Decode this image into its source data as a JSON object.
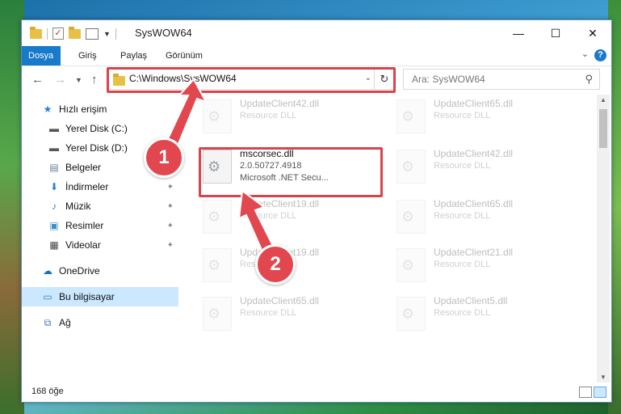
{
  "window": {
    "title": "SysWOW64",
    "minimize_glyph": "—",
    "maximize_glyph": "☐",
    "close_glyph": "✕"
  },
  "ribbon": {
    "tabs": [
      "Dosya",
      "Giriş",
      "Paylaş",
      "Görünüm"
    ],
    "collapse_glyph": "⌄",
    "help_glyph": "?"
  },
  "address": {
    "path": "C:\\Windows\\SysWOW64",
    "search_placeholder": "Ara: SysWOW64"
  },
  "sidebar": {
    "items": [
      {
        "label": "Hızlı erişim",
        "icon": "star-icon"
      },
      {
        "label": "Yerel Disk (C:)",
        "icon": "drive-icon"
      },
      {
        "label": "Yerel Disk (D:)",
        "icon": "drive-icon"
      },
      {
        "label": "Belgeler",
        "icon": "documents-icon"
      },
      {
        "label": "İndirmeler",
        "icon": "download-icon"
      },
      {
        "label": "Müzik",
        "icon": "music-icon"
      },
      {
        "label": "Resimler",
        "icon": "pictures-icon"
      },
      {
        "label": "Videolar",
        "icon": "video-icon"
      },
      {
        "label": "OneDrive",
        "icon": "cloud-icon"
      },
      {
        "label": "Bu bilgisayar",
        "icon": "computer-icon"
      },
      {
        "label": "Ağ",
        "icon": "network-icon"
      }
    ]
  },
  "files": {
    "highlighted": {
      "name": "mscorsec.dll",
      "version": "2.0.50727.4918",
      "description": "Microsoft .NET Secu..."
    },
    "faded": [
      {
        "name": "UpdateClient42.dll",
        "type": "Resource DLL"
      },
      {
        "name": "UpdateClient65.dll",
        "type": "Resource DLL"
      },
      {
        "name": "UpdateClient42.dll",
        "type": "Resource DLL"
      },
      {
        "name": "UpdateClient19.dll",
        "type": "Resource DLL"
      },
      {
        "name": "UpdateClient65.dll",
        "type": "Resource DLL"
      },
      {
        "name": "UpdateClient19.dll",
        "type": "Resource DLL"
      },
      {
        "name": "UpdateClient21.dll",
        "type": "Resource DLL"
      },
      {
        "name": "UpdateClient65.dll",
        "type": "Resource DLL"
      },
      {
        "name": "UpdateClient5.dll",
        "type": "Resource DLL"
      }
    ]
  },
  "status": {
    "count": "168 öğe"
  },
  "callouts": {
    "one": "1",
    "two": "2"
  },
  "colors": {
    "accent": "#1979ca",
    "highlight": "#d9444b",
    "selected": "#cce8ff"
  }
}
